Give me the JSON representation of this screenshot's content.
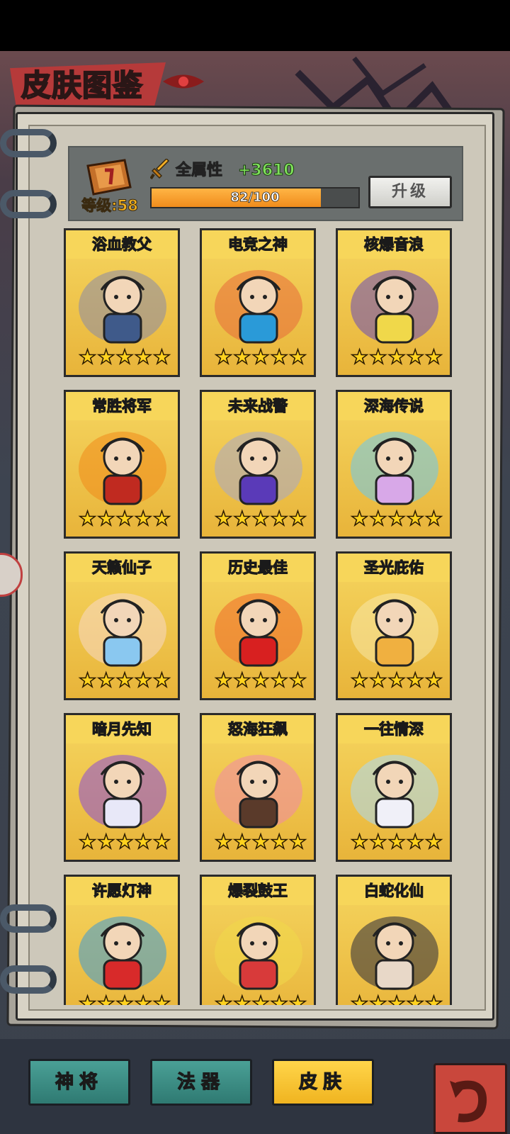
{
  "page": {
    "title": "皮肤图鉴"
  },
  "stats": {
    "level_label": "等级:58",
    "attr_label": "全属性",
    "attr_value": "+3610",
    "progress_text": "82/100",
    "progress_fraction": 0.82,
    "upgrade_label": "升级"
  },
  "skins": [
    {
      "name": "浴血教父",
      "stars": 5
    },
    {
      "name": "电竞之神",
      "stars": 5
    },
    {
      "name": "核爆音浪",
      "stars": 5
    },
    {
      "name": "常胜将军",
      "stars": 5
    },
    {
      "name": "未来战警",
      "stars": 5
    },
    {
      "name": "深海传说",
      "stars": 5
    },
    {
      "name": "天籁仙子",
      "stars": 5
    },
    {
      "name": "历史最佳",
      "stars": 5
    },
    {
      "name": "圣光庇佑",
      "stars": 5
    },
    {
      "name": "暗月先知",
      "stars": 5
    },
    {
      "name": "怒海狂飙",
      "stars": 5
    },
    {
      "name": "一往情深",
      "stars": 5
    },
    {
      "name": "许愿灯神",
      "stars": 5
    },
    {
      "name": "爆裂鼓王",
      "stars": 5
    },
    {
      "name": "白蛇化仙",
      "stars": 5
    }
  ],
  "tabs": [
    {
      "label": "神将",
      "active": false
    },
    {
      "label": "法器",
      "active": false
    },
    {
      "label": "皮肤",
      "active": true
    }
  ],
  "colors": {
    "accent": "#f4cf52",
    "title_banner": "#b63a3a",
    "attr_value": "#7ee05a",
    "progress": "#f08c1c"
  },
  "icons": {
    "level_badge": "scroll-badge-icon",
    "attr": "sword-icon",
    "back": "back-arrow-icon",
    "side": "gamepad-icon"
  }
}
